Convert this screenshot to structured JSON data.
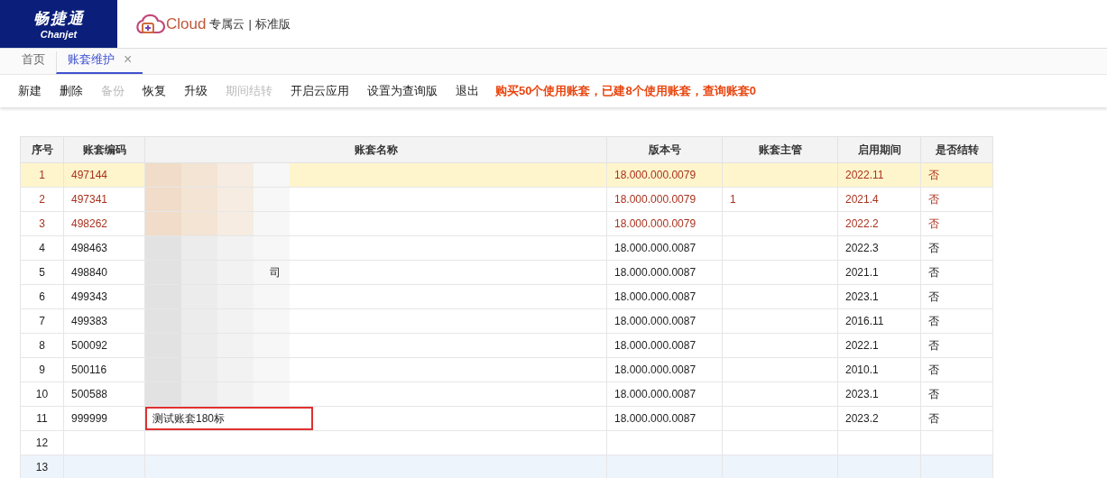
{
  "brand": {
    "name": "畅捷通",
    "sub": "Chanjet",
    "product": "Cloud",
    "edition_a": "专属云",
    "separator": "|",
    "edition_b": "标准版"
  },
  "tabs": [
    {
      "label": "首页",
      "selected": false,
      "closable": false
    },
    {
      "label": "账套维护",
      "selected": true,
      "closable": true,
      "close": "×"
    }
  ],
  "toolbar": [
    {
      "label": "新建",
      "disabled": false
    },
    {
      "label": "删除",
      "disabled": false
    },
    {
      "label": "备份",
      "disabled": true
    },
    {
      "label": "恢复",
      "disabled": false
    },
    {
      "label": "升级",
      "disabled": false
    },
    {
      "label": "期间结转",
      "disabled": true
    },
    {
      "label": "开启云应用",
      "disabled": false
    },
    {
      "label": "设置为查询版",
      "disabled": false
    },
    {
      "label": "退出",
      "disabled": false
    }
  ],
  "notice": "购买50个使用账套，已建8个使用账套，查询账套0",
  "table": {
    "columns": [
      "序号",
      "账套编码",
      "账套名称",
      "版本号",
      "账套主管",
      "启用期间",
      "是否结转"
    ],
    "rows": [
      {
        "no": "1",
        "code": "497144",
        "name": "",
        "version": "18.000.000.0079",
        "manager": "",
        "period": "2022.11",
        "closed": "否",
        "alert": true,
        "selected": true,
        "hovered": false,
        "redacted": true,
        "marked": false
      },
      {
        "no": "2",
        "code": "497341",
        "name": "",
        "version": "18.000.000.0079",
        "manager": "1",
        "period": "2021.4",
        "closed": "否",
        "alert": true,
        "selected": false,
        "hovered": false,
        "redacted": true,
        "marked": false
      },
      {
        "no": "3",
        "code": "498262",
        "name": "",
        "version": "18.000.000.0079",
        "manager": "",
        "period": "2022.2",
        "closed": "否",
        "alert": true,
        "selected": false,
        "hovered": false,
        "redacted": true,
        "marked": false
      },
      {
        "no": "4",
        "code": "498463",
        "name": "",
        "version": "18.000.000.0087",
        "manager": "",
        "period": "2022.3",
        "closed": "否",
        "alert": false,
        "selected": false,
        "hovered": false,
        "redacted": true,
        "marked": false
      },
      {
        "no": "5",
        "code": "498840",
        "name": "司",
        "version": "18.000.000.0087",
        "manager": "",
        "period": "2021.1",
        "closed": "否",
        "alert": false,
        "selected": false,
        "hovered": false,
        "redacted": true,
        "marked": false
      },
      {
        "no": "6",
        "code": "499343",
        "name": "",
        "version": "18.000.000.0087",
        "manager": "",
        "period": "2023.1",
        "closed": "否",
        "alert": false,
        "selected": false,
        "hovered": false,
        "redacted": true,
        "marked": false
      },
      {
        "no": "7",
        "code": "499383",
        "name": "",
        "version": "18.000.000.0087",
        "manager": "",
        "period": "2016.11",
        "closed": "否",
        "alert": false,
        "selected": false,
        "hovered": false,
        "redacted": true,
        "marked": false
      },
      {
        "no": "8",
        "code": "500092",
        "name": "",
        "version": "18.000.000.0087",
        "manager": "",
        "period": "2022.1",
        "closed": "否",
        "alert": false,
        "selected": false,
        "hovered": false,
        "redacted": true,
        "marked": false
      },
      {
        "no": "9",
        "code": "500116",
        "name": "",
        "version": "18.000.000.0087",
        "manager": "",
        "period": "2010.1",
        "closed": "否",
        "alert": false,
        "selected": false,
        "hovered": false,
        "redacted": true,
        "marked": false
      },
      {
        "no": "10",
        "code": "500588",
        "name": "",
        "version": "18.000.000.0087",
        "manager": "",
        "period": "2023.1",
        "closed": "否",
        "alert": false,
        "selected": false,
        "hovered": false,
        "redacted": true,
        "marked": false
      },
      {
        "no": "11",
        "code": "999999",
        "name": "测试账套180标",
        "version": "18.000.000.0087",
        "manager": "",
        "period": "2023.2",
        "closed": "否",
        "alert": false,
        "selected": false,
        "hovered": false,
        "redacted": false,
        "marked": true
      },
      {
        "no": "12",
        "code": "",
        "name": "",
        "version": "",
        "manager": "",
        "period": "",
        "closed": "",
        "selected": false,
        "hovered": false,
        "redacted": false,
        "marked": false
      },
      {
        "no": "13",
        "code": "",
        "name": "",
        "version": "",
        "manager": "",
        "period": "",
        "closed": "",
        "selected": false,
        "hovered": true,
        "redacted": false,
        "marked": false
      }
    ]
  }
}
